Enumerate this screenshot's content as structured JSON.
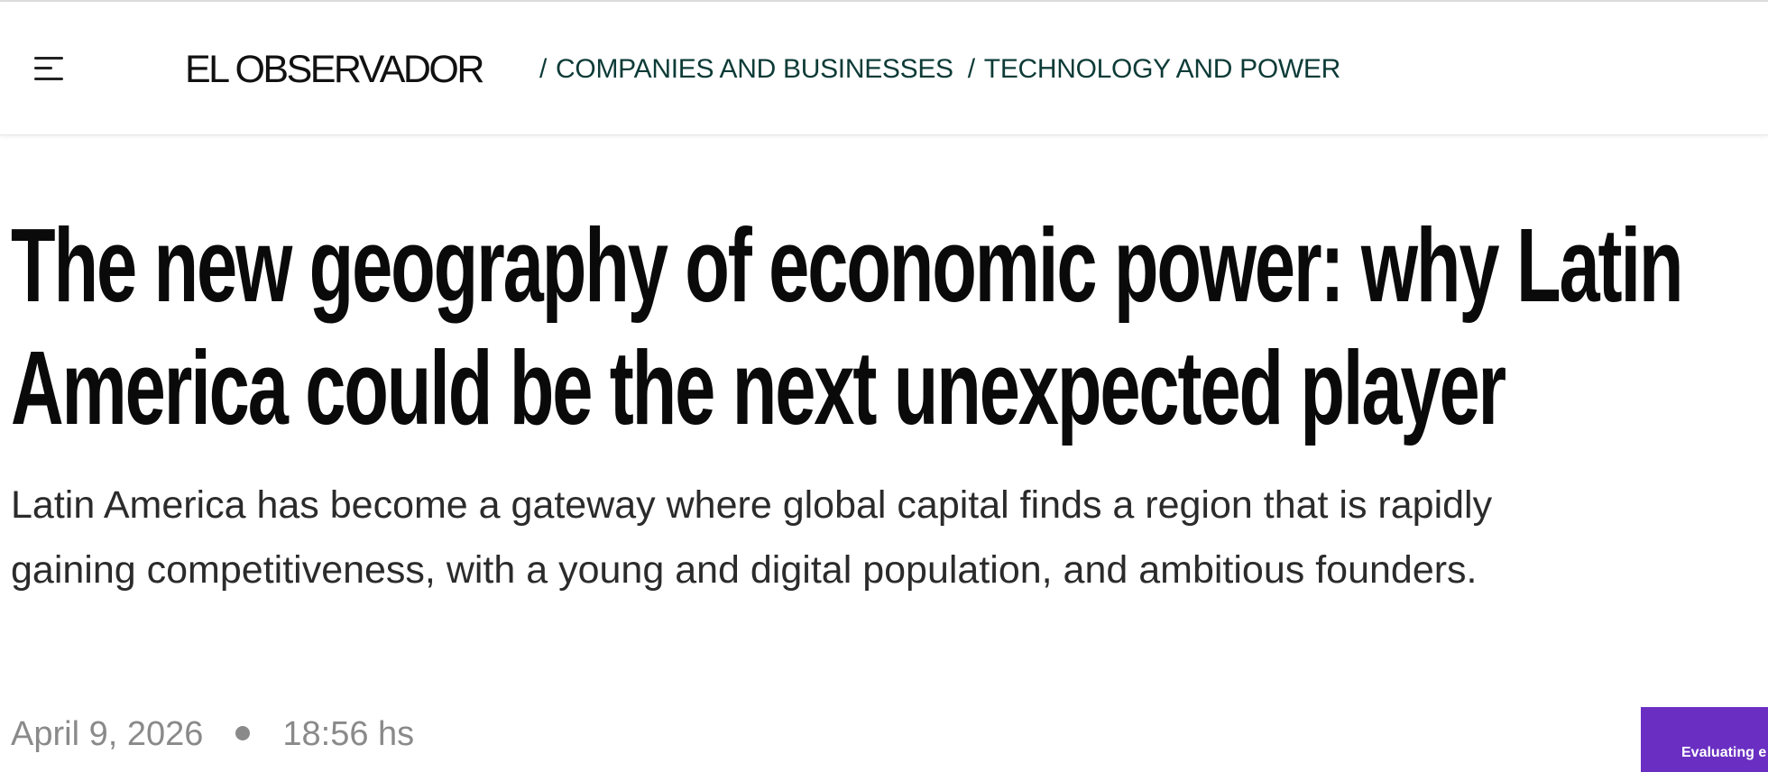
{
  "header": {
    "menu_icon": "hamburger-menu-icon",
    "logo_text": "EL OBSERVADOR",
    "breadcrumb": [
      {
        "separator": "/",
        "label": "COMPANIES AND BUSINESSES"
      },
      {
        "separator": "/",
        "label": "TECHNOLOGY AND POWER"
      }
    ]
  },
  "article": {
    "headline": "The new geography of economic power: why Latin America could be the next unexpected player",
    "subheadline": "Latin America has become a gateway where global capital finds a region that is rapidly gaining competitiveness, with a young and digital population, and ambitious founders.",
    "date": "April 9, 2026",
    "time": "18:56 hs"
  },
  "promo": {
    "label": "Evaluating e",
    "color": "#6a2fc2"
  },
  "colors": {
    "breadcrumb": "#0d3b37",
    "headline": "#0a0a0a",
    "meta": "#8a8a8a"
  }
}
